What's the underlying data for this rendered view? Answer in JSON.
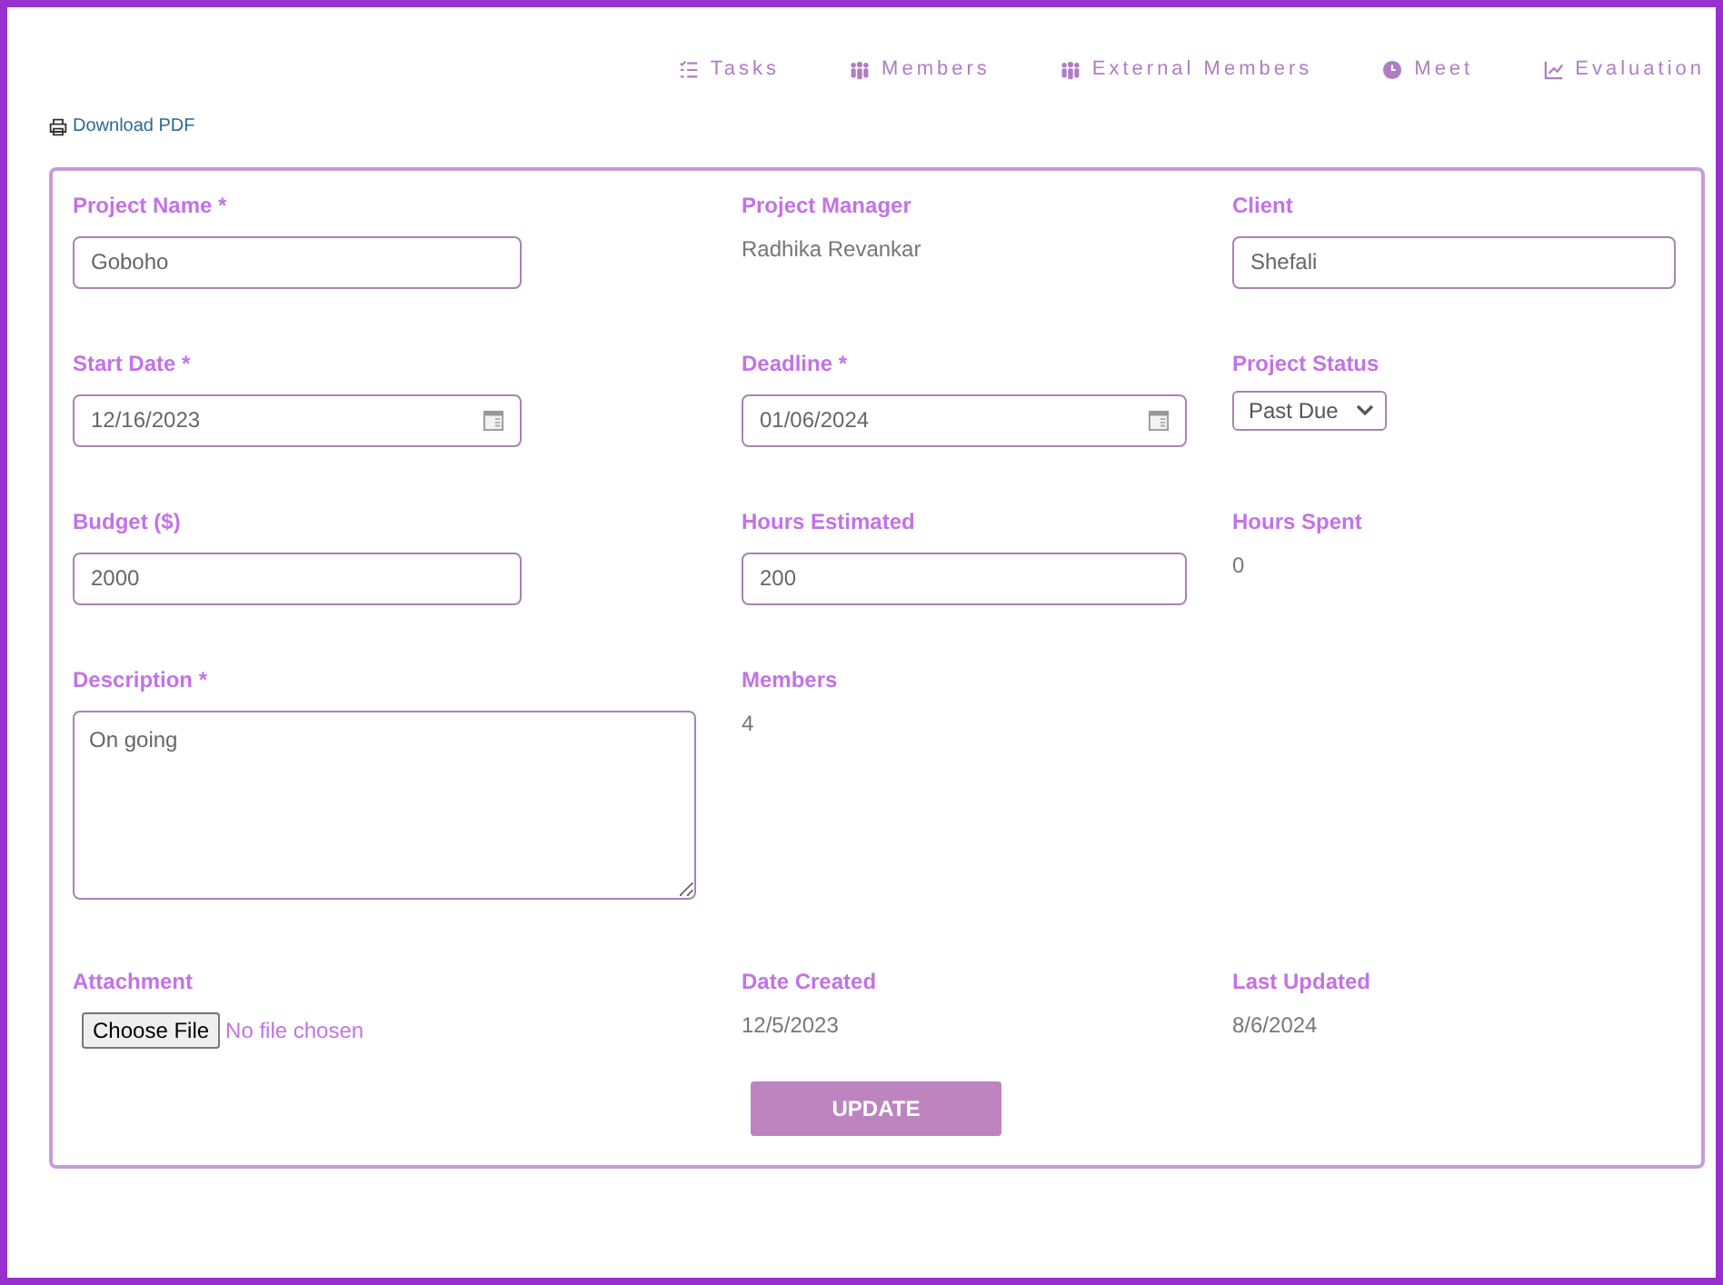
{
  "nav": [
    {
      "label": "Tasks",
      "kind": "tasks"
    },
    {
      "label": "Members",
      "kind": "people"
    },
    {
      "label": "External Members",
      "kind": "people"
    },
    {
      "label": "Meet",
      "kind": "clock"
    },
    {
      "label": "Evaluation",
      "kind": "chart"
    }
  ],
  "download": {
    "label": "Download PDF"
  },
  "form": {
    "rows": [
      [
        {
          "label": "Project Name *",
          "kind": "input",
          "value": "Goboho"
        },
        {
          "label": "Project Manager",
          "kind": "text",
          "value": "Radhika Revankar"
        },
        {
          "label": "Client",
          "kind": "input",
          "value": "Shefali"
        }
      ],
      [
        {
          "label": "Start Date *",
          "kind": "date",
          "value": "12/16/2023"
        },
        {
          "label": "Deadline *",
          "kind": "date",
          "value": "01/06/2024"
        },
        {
          "label": "Project Status",
          "kind": "select",
          "value": "Past Due"
        }
      ],
      [
        {
          "label": "Budget ($)",
          "kind": "input",
          "value": "2000"
        },
        {
          "label": "Hours Estimated",
          "kind": "input",
          "value": "200"
        },
        {
          "label": "Hours Spent",
          "kind": "text",
          "value": "0"
        }
      ],
      [
        {
          "label": "Description *",
          "kind": "textarea",
          "value": "On going"
        },
        {
          "label": "Members",
          "kind": "text",
          "value": "4"
        }
      ],
      [
        {
          "label": "Attachment",
          "kind": "file",
          "button": "Choose File",
          "value": "No file chosen"
        },
        {
          "label": "Date Created",
          "kind": "text",
          "value": "12/5/2023"
        },
        {
          "label": "Last Updated",
          "kind": "text",
          "value": "8/6/2024"
        }
      ]
    ],
    "submit": "UPDATE"
  }
}
